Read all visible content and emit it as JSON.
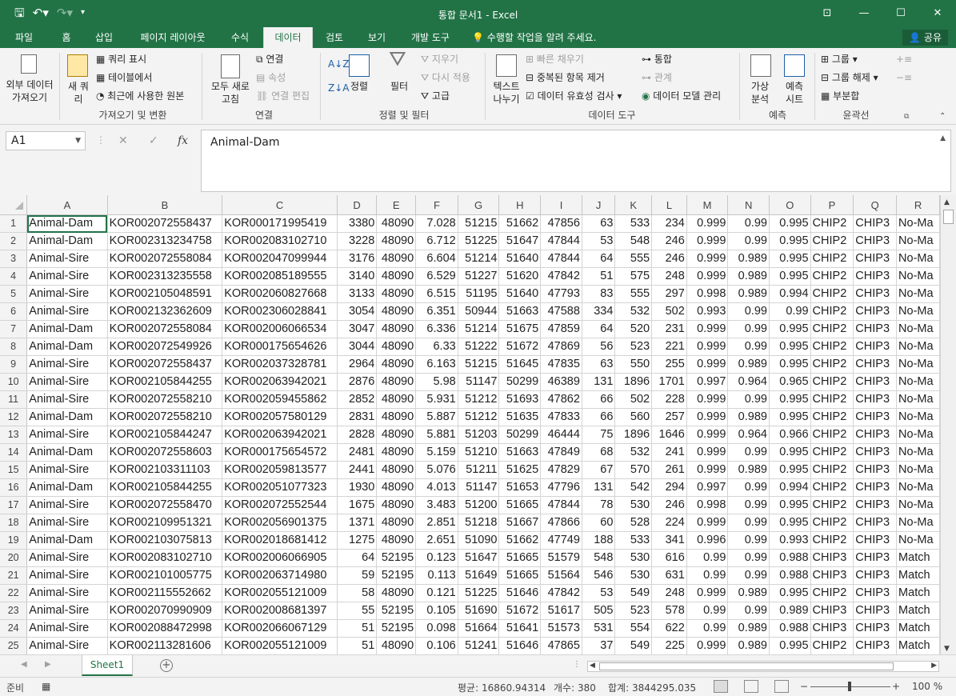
{
  "window": {
    "title": "통합 문서1 - Excel"
  },
  "qat": {
    "save_icon": "save-icon",
    "undo_icon": "undo-icon",
    "redo_icon": "redo-icon"
  },
  "tabs": [
    "파일",
    "홈",
    "삽입",
    "페이지 레이아웃",
    "수식",
    "데이터",
    "검토",
    "보기",
    "개발 도구"
  ],
  "tell_me": "수행할 작업을 알려 주세요.",
  "share": "공유",
  "ribbon": {
    "get_external": [
      "외부 데이터",
      "가져오기"
    ],
    "new_query": [
      "새 쿼",
      "리"
    ],
    "show_queries": "쿼리 표시",
    "from_table": "테이블에서",
    "recent_sources": "최근에 사용한 원본",
    "group_get_transform": "가져오기 및 변환",
    "refresh_all": [
      "모두 새로",
      "고침"
    ],
    "connections": "연결",
    "properties": "속성",
    "edit_links": "연결 편집",
    "group_connections": "연결",
    "sort": "정렬",
    "filter": "필터",
    "clear": "지우기",
    "reapply": "다시 적용",
    "advanced": "고급",
    "group_sort_filter": "정렬 및 필터",
    "text_to_columns": [
      "텍스트",
      "나누기"
    ],
    "flash_fill": "빠른 채우기",
    "remove_duplicates": "중복된 항목 제거",
    "data_validation": "데이터 유효성 검사",
    "consolidate": "통합",
    "relationships": "관계",
    "data_model": "데이터 모델 관리",
    "group_data_tools": "데이터 도구",
    "what_if": [
      "가상",
      "분석"
    ],
    "forecast_sheet": [
      "예측",
      "시트"
    ],
    "group_forecast": "예측",
    "group": "그룹",
    "ungroup": "그룹 해제",
    "subtotal": "부분합",
    "group_outline": "윤곽선"
  },
  "name_box": "A1",
  "formula": "Animal-Dam",
  "columns": [
    "A",
    "B",
    "C",
    "D",
    "E",
    "F",
    "G",
    "H",
    "I",
    "J",
    "K",
    "L",
    "M",
    "N",
    "O",
    "P",
    "Q",
    "R"
  ],
  "rows": [
    [
      "Animal-Dam",
      "KOR002072558437",
      "KOR000171995419",
      "3380",
      "48090",
      "7.028",
      "51215",
      "51662",
      "47856",
      "63",
      "533",
      "234",
      "0.999",
      "0.99",
      "0.995",
      "CHIP2",
      "CHIP3",
      "No-Ma"
    ],
    [
      "Animal-Dam",
      "KOR002313234758",
      "KOR002083102710",
      "3228",
      "48090",
      "6.712",
      "51225",
      "51647",
      "47844",
      "53",
      "548",
      "246",
      "0.999",
      "0.99",
      "0.995",
      "CHIP2",
      "CHIP3",
      "No-Ma"
    ],
    [
      "Animal-Sire",
      "KOR002072558084",
      "KOR002047099944",
      "3176",
      "48090",
      "6.604",
      "51214",
      "51640",
      "47844",
      "64",
      "555",
      "246",
      "0.999",
      "0.989",
      "0.995",
      "CHIP2",
      "CHIP3",
      "No-Ma"
    ],
    [
      "Animal-Sire",
      "KOR002313235558",
      "KOR002085189555",
      "3140",
      "48090",
      "6.529",
      "51227",
      "51620",
      "47842",
      "51",
      "575",
      "248",
      "0.999",
      "0.989",
      "0.995",
      "CHIP2",
      "CHIP3",
      "No-Ma"
    ],
    [
      "Animal-Sire",
      "KOR002105048591",
      "KOR002060827668",
      "3133",
      "48090",
      "6.515",
      "51195",
      "51640",
      "47793",
      "83",
      "555",
      "297",
      "0.998",
      "0.989",
      "0.994",
      "CHIP2",
      "CHIP3",
      "No-Ma"
    ],
    [
      "Animal-Sire",
      "KOR002132362609",
      "KOR002306028841",
      "3054",
      "48090",
      "6.351",
      "50944",
      "51663",
      "47588",
      "334",
      "532",
      "502",
      "0.993",
      "0.99",
      "0.99",
      "CHIP2",
      "CHIP3",
      "No-Ma"
    ],
    [
      "Animal-Dam",
      "KOR002072558084",
      "KOR002006066534",
      "3047",
      "48090",
      "6.336",
      "51214",
      "51675",
      "47859",
      "64",
      "520",
      "231",
      "0.999",
      "0.99",
      "0.995",
      "CHIP2",
      "CHIP3",
      "No-Ma"
    ],
    [
      "Animal-Dam",
      "KOR002072549926",
      "KOR000175654626",
      "3044",
      "48090",
      "6.33",
      "51222",
      "51672",
      "47869",
      "56",
      "523",
      "221",
      "0.999",
      "0.99",
      "0.995",
      "CHIP2",
      "CHIP3",
      "No-Ma"
    ],
    [
      "Animal-Sire",
      "KOR002072558437",
      "KOR002037328781",
      "2964",
      "48090",
      "6.163",
      "51215",
      "51645",
      "47835",
      "63",
      "550",
      "255",
      "0.999",
      "0.989",
      "0.995",
      "CHIP2",
      "CHIP3",
      "No-Ma"
    ],
    [
      "Animal-Sire",
      "KOR002105844255",
      "KOR002063942021",
      "2876",
      "48090",
      "5.98",
      "51147",
      "50299",
      "46389",
      "131",
      "1896",
      "1701",
      "0.997",
      "0.964",
      "0.965",
      "CHIP2",
      "CHIP3",
      "No-Ma"
    ],
    [
      "Animal-Sire",
      "KOR002072558210",
      "KOR002059455862",
      "2852",
      "48090",
      "5.931",
      "51212",
      "51693",
      "47862",
      "66",
      "502",
      "228",
      "0.999",
      "0.99",
      "0.995",
      "CHIP2",
      "CHIP3",
      "No-Ma"
    ],
    [
      "Animal-Dam",
      "KOR002072558210",
      "KOR002057580129",
      "2831",
      "48090",
      "5.887",
      "51212",
      "51635",
      "47833",
      "66",
      "560",
      "257",
      "0.999",
      "0.989",
      "0.995",
      "CHIP2",
      "CHIP3",
      "No-Ma"
    ],
    [
      "Animal-Sire",
      "KOR002105844247",
      "KOR002063942021",
      "2828",
      "48090",
      "5.881",
      "51203",
      "50299",
      "46444",
      "75",
      "1896",
      "1646",
      "0.999",
      "0.964",
      "0.966",
      "CHIP2",
      "CHIP3",
      "No-Ma"
    ],
    [
      "Animal-Dam",
      "KOR002072558603",
      "KOR000175654572",
      "2481",
      "48090",
      "5.159",
      "51210",
      "51663",
      "47849",
      "68",
      "532",
      "241",
      "0.999",
      "0.99",
      "0.995",
      "CHIP2",
      "CHIP3",
      "No-Ma"
    ],
    [
      "Animal-Sire",
      "KOR002103311103",
      "KOR002059813577",
      "2441",
      "48090",
      "5.076",
      "51211",
      "51625",
      "47829",
      "67",
      "570",
      "261",
      "0.999",
      "0.989",
      "0.995",
      "CHIP2",
      "CHIP3",
      "No-Ma"
    ],
    [
      "Animal-Dam",
      "KOR002105844255",
      "KOR002051077323",
      "1930",
      "48090",
      "4.013",
      "51147",
      "51653",
      "47796",
      "131",
      "542",
      "294",
      "0.997",
      "0.99",
      "0.994",
      "CHIP2",
      "CHIP3",
      "No-Ma"
    ],
    [
      "Animal-Sire",
      "KOR002072558470",
      "KOR002072552544",
      "1675",
      "48090",
      "3.483",
      "51200",
      "51665",
      "47844",
      "78",
      "530",
      "246",
      "0.998",
      "0.99",
      "0.995",
      "CHIP2",
      "CHIP3",
      "No-Ma"
    ],
    [
      "Animal-Sire",
      "KOR002109951321",
      "KOR002056901375",
      "1371",
      "48090",
      "2.851",
      "51218",
      "51667",
      "47866",
      "60",
      "528",
      "224",
      "0.999",
      "0.99",
      "0.995",
      "CHIP2",
      "CHIP3",
      "No-Ma"
    ],
    [
      "Animal-Dam",
      "KOR002103075813",
      "KOR002018681412",
      "1275",
      "48090",
      "2.651",
      "51090",
      "51662",
      "47749",
      "188",
      "533",
      "341",
      "0.996",
      "0.99",
      "0.993",
      "CHIP2",
      "CHIP3",
      "No-Ma"
    ],
    [
      "Animal-Sire",
      "KOR002083102710",
      "KOR002006066905",
      "64",
      "52195",
      "0.123",
      "51647",
      "51665",
      "51579",
      "548",
      "530",
      "616",
      "0.99",
      "0.99",
      "0.988",
      "CHIP3",
      "CHIP3",
      "Match"
    ],
    [
      "Animal-Sire",
      "KOR002101005775",
      "KOR002063714980",
      "59",
      "52195",
      "0.113",
      "51649",
      "51665",
      "51564",
      "546",
      "530",
      "631",
      "0.99",
      "0.99",
      "0.988",
      "CHIP3",
      "CHIP3",
      "Match"
    ],
    [
      "Animal-Sire",
      "KOR002115552662",
      "KOR002055121009",
      "58",
      "48090",
      "0.121",
      "51225",
      "51646",
      "47842",
      "53",
      "549",
      "248",
      "0.999",
      "0.989",
      "0.995",
      "CHIP2",
      "CHIP3",
      "Match"
    ],
    [
      "Animal-Sire",
      "KOR002070990909",
      "KOR002008681397",
      "55",
      "52195",
      "0.105",
      "51690",
      "51672",
      "51617",
      "505",
      "523",
      "578",
      "0.99",
      "0.99",
      "0.989",
      "CHIP3",
      "CHIP3",
      "Match"
    ],
    [
      "Animal-Sire",
      "KOR002088472998",
      "KOR002066067129",
      "51",
      "52195",
      "0.098",
      "51664",
      "51641",
      "51573",
      "531",
      "554",
      "622",
      "0.99",
      "0.989",
      "0.988",
      "CHIP3",
      "CHIP3",
      "Match"
    ],
    [
      "Animal-Sire",
      "KOR002113281606",
      "KOR002055121009",
      "51",
      "48090",
      "0.106",
      "51241",
      "51646",
      "47865",
      "37",
      "549",
      "225",
      "0.999",
      "0.989",
      "0.995",
      "CHIP2",
      "CHIP3",
      "Match"
    ]
  ],
  "sheet_tab": "Sheet1",
  "status": {
    "ready": "준비",
    "average": "평균: 16860.94314",
    "count": "개수: 380",
    "sum": "합계: 3844295.035",
    "zoom": "100 %"
  }
}
